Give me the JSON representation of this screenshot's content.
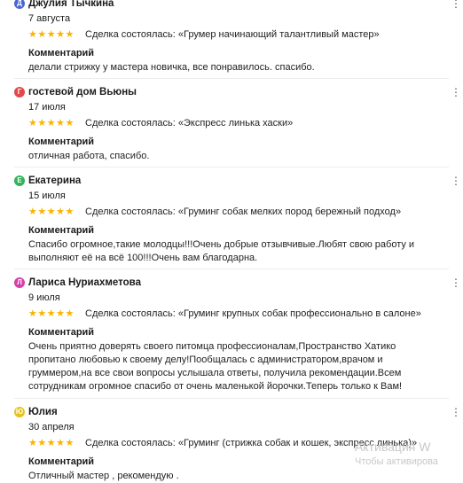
{
  "reviews": [
    {
      "avatar_letter": "Д",
      "avatar_color": "#4a66d6",
      "author": "Джулия Тычкина",
      "date": "7 августа",
      "stars": "★★★★★",
      "deal": "Сделка состоялась: «Грумер начинающий талантливый мастер»",
      "comment_label": "Комментарий",
      "comment": "делали стрижку у мастера новичка, все понравилось. спасибо.",
      "more_icon": "⋮"
    },
    {
      "avatar_letter": "Г",
      "avatar_color": "#e04a4a",
      "author": "гостевой дом Вьюны",
      "date": "17 июля",
      "stars": "★★★★★",
      "deal": "Сделка состоялась: «Экспресс линька хаски»",
      "comment_label": "Комментарий",
      "comment": "отличная работа, спасибо.",
      "more_icon": "⋮"
    },
    {
      "avatar_letter": "Е",
      "avatar_color": "#33b35a",
      "author": "Екатерина",
      "date": "15 июля",
      "stars": "★★★★★",
      "deal": "Сделка состоялась: «Груминг собак мелких пород бережный подход»",
      "comment_label": "Комментарий",
      "comment": "Спасибо огромное,такие молодцы!!!Очень добрые отзывчивые.Любят свою работу и выполняют её на всё 100!!!Очень вам благодарна.",
      "more_icon": "⋮"
    },
    {
      "avatar_letter": "Л",
      "avatar_color": "#d63fa8",
      "author": "Лариса Нуриахметова",
      "date": "9 июля",
      "stars": "★★★★★",
      "deal": "Сделка состоялась: «Груминг крупных собак профессионально в салоне»",
      "comment_label": "Комментарий",
      "comment": "Очень приятно доверять своего питомца профессионалам,Пространство Хатико пропитано любовью к своему делу!Пообщалась с администратором,врачом и груммером,на все свои вопросы услышала ответы, получила рекомендации.Всем сотрудникам огромное спасибо от очень маленькой йорочки.Теперь только к Вам!",
      "more_icon": "⋮"
    },
    {
      "avatar_letter": "Ю",
      "avatar_color": "#e6c21f",
      "author": "Юлия",
      "date": "30 апреля",
      "stars": "★★★★★",
      "deal": "Сделка состоялась: «Груминг (стрижка собак и кошек, экспресс линька)»",
      "comment_label": "Комментарий",
      "comment": "Отличный мастер , рекомендую .",
      "more_icon": "⋮"
    }
  ],
  "watermark": {
    "line1": "Активация W",
    "line2": "Чтобы активирова"
  }
}
